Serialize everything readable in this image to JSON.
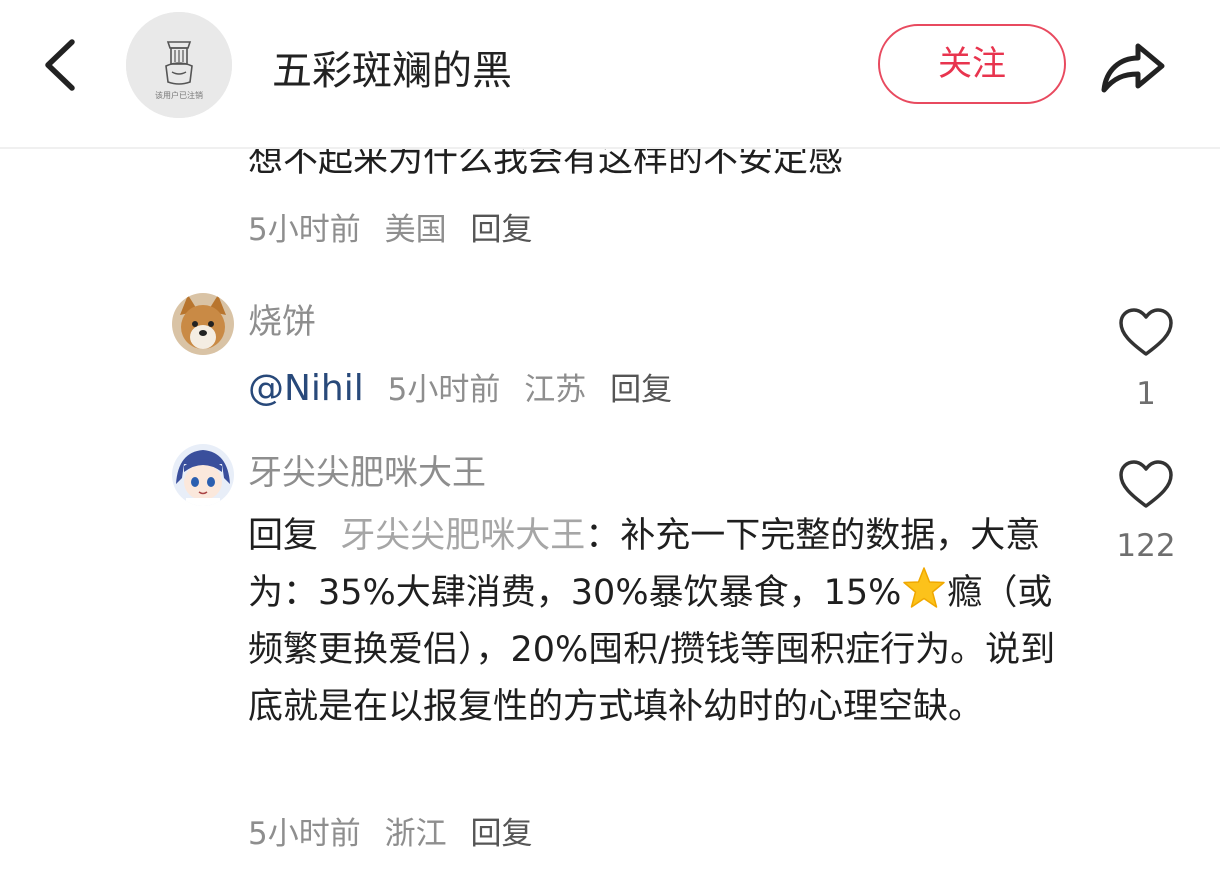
{
  "header": {
    "author_name": "五彩斑斓的黑",
    "avatar_caption": "该用户已注销",
    "follow_label": "关注"
  },
  "comments": [
    {
      "text": "想不起来为什么我会有这样的不安定感",
      "time": "5小时前",
      "location": "美国",
      "reply_label": "回复"
    },
    {
      "username": "烧饼",
      "mention": "@Nihil",
      "time": "5小时前",
      "location": "江苏",
      "reply_label": "回复",
      "likes": "1"
    },
    {
      "username": "牙尖尖肥咪大王",
      "reply_prefix": "回复",
      "reply_to": "牙尖尖肥咪大王",
      "text_part1": "：补充一下完整的数据，大意为：35%大肆消费，30%暴饮暴食，15%",
      "star_emoji": "star",
      "text_part2": "瘾（或频繁更换爱侣），20%囤积/攒钱等囤积症行为。说到底就是在以报复性的方式填补幼时的心理空缺。",
      "time": "5小时前",
      "location": "浙江",
      "reply_label": "回复",
      "likes": "122"
    }
  ],
  "colors": {
    "follow_red": "#e8344e",
    "mention_blue": "#28497a",
    "meta_gray": "#8e8e8e"
  },
  "icons": [
    "back-arrow-icon",
    "share-arrow-icon",
    "heart-outline-icon",
    "star-emoji-icon"
  ]
}
